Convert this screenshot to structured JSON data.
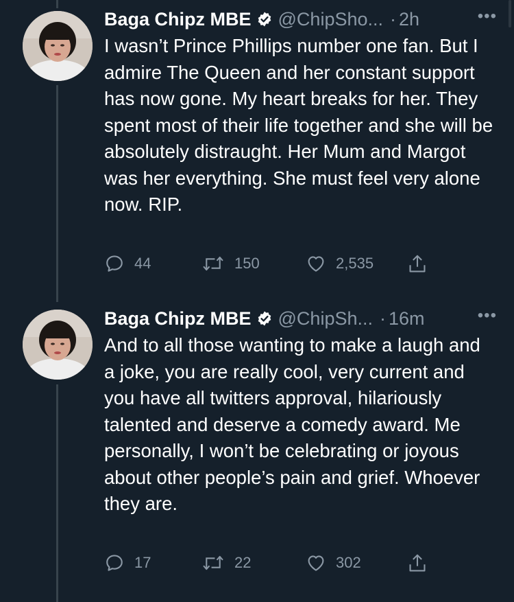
{
  "tweets": [
    {
      "display_name": "Baga Chipz MBE",
      "handle": "@ChipSho...",
      "separator": "·",
      "time": "2h",
      "more": "•••",
      "text": "I wasn’t Prince Phillips number one fan. But I admire The Queen and her constant support has now gone. My heart breaks for her. They spent  most of their life together and she will be absolutely distraught. Her Mum and Margot was her everything. She must feel very alone now. RIP.",
      "replies": "44",
      "retweets": "150",
      "likes": "2,535"
    },
    {
      "display_name": "Baga Chipz MBE",
      "handle": "@ChipSh...",
      "separator": "·",
      "time": "16m",
      "more": "•••",
      "text": "And to all those wanting to make a laugh and a joke, you are really cool, very current and you have all twitters approval, hilariously talented and deserve a comedy award. Me personally, I won’t be celebrating or joyous about other people’s pain and grief. Whoever they are.",
      "replies": "17",
      "retweets": "22",
      "likes": "302"
    }
  ],
  "colors": {
    "background": "#15202b",
    "secondary_text": "#8b98a5",
    "thread_line": "#38444d",
    "verified_badge": "#ffffff"
  },
  "icons": [
    "verified-badge-icon",
    "reply-icon",
    "retweet-icon",
    "like-icon",
    "share-icon",
    "more-icon"
  ]
}
